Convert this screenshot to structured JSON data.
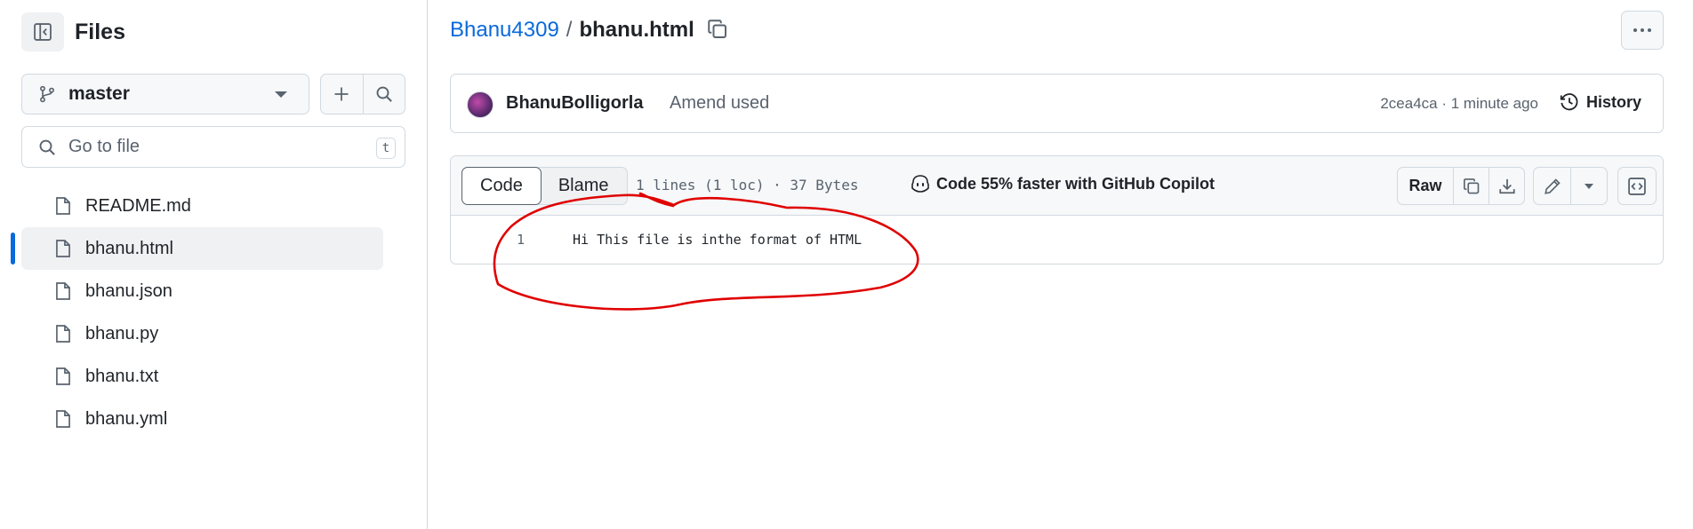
{
  "sidebar": {
    "title": "Files",
    "branch": "master",
    "goto_placeholder": "Go to file",
    "goto_shortcut": "t",
    "files": [
      {
        "name": "README.md",
        "active": false
      },
      {
        "name": "bhanu.html",
        "active": true
      },
      {
        "name": "bhanu.json",
        "active": false
      },
      {
        "name": "bhanu.py",
        "active": false
      },
      {
        "name": "bhanu.txt",
        "active": false
      },
      {
        "name": "bhanu.yml",
        "active": false
      }
    ]
  },
  "breadcrumb": {
    "owner": "Bhanu4309",
    "separator": "/",
    "file": "bhanu.html"
  },
  "commit": {
    "author": "BhanuBolligorla",
    "message": "Amend used",
    "meta": "2cea4ca · 1 minute ago",
    "history_label": "History"
  },
  "code_view": {
    "tabs": [
      "Code",
      "Blame"
    ],
    "selected_tab": "Code",
    "stats": "1 lines (1 loc) · 37 Bytes",
    "copilot_text": "Code 55% faster with GitHub Copilot",
    "raw_label": "Raw",
    "lines": [
      {
        "number": "1",
        "text": "Hi This file is inthe format of HTML"
      }
    ]
  },
  "colors": {
    "link": "#0969da",
    "annotation": "#e00000",
    "border": "#d1d9e0"
  },
  "icons": [
    "sidebar-collapse-icon",
    "git-branch-icon",
    "plus-icon",
    "search-icon",
    "file-icon",
    "copy-icon",
    "kebab-horizontal-icon",
    "history-icon",
    "copilot-icon",
    "download-icon",
    "pencil-icon",
    "triangle-down-icon",
    "code-square-icon"
  ]
}
